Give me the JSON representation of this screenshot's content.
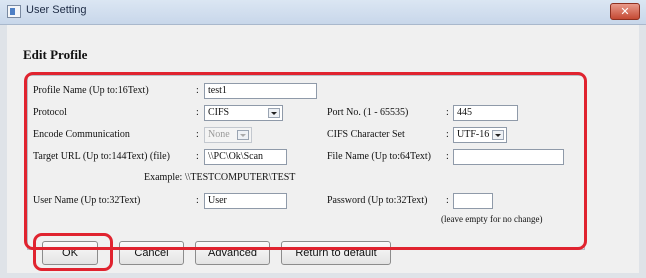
{
  "window": {
    "title": "User Setting",
    "close_glyph": "✕",
    "app_icon": "window-app-icon"
  },
  "heading": "Edit Profile",
  "form": {
    "profile_name_label": "Profile Name (Up to:16Text)",
    "profile_name_value": "test1",
    "protocol_label": "Protocol",
    "protocol_value": "CIFS",
    "port_label": "Port No. (1 - 65535)",
    "port_value": "445",
    "encode_label": "Encode Communication",
    "encode_value": "None",
    "charset_label": "CIFS Character Set",
    "charset_value": "UTF-16",
    "target_url_label": "Target URL (Up to:144Text) (file)",
    "target_url_value": "\\\\PC\\Ok\\Scan",
    "file_name_label": "File Name (Up to:64Text)",
    "file_name_value": "",
    "example_text": "Example: \\\\TESTCOMPUTER\\TEST",
    "user_name_label": "User Name (Up to:32Text)",
    "user_name_value": "User",
    "password_label": "Password (Up to:32Text)",
    "password_value": "",
    "password_note": "(leave empty for no change)",
    "colon": ":"
  },
  "buttons": {
    "ok": "OK",
    "cancel": "Cancel",
    "advanced": "Advanced",
    "return_default": "Return to default"
  },
  "colors": {
    "highlight": "#e0232f"
  }
}
